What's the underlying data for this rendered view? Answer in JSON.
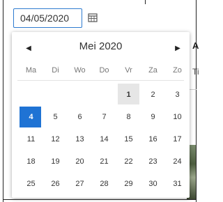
{
  "datepicker": {
    "input_value": "04/05/2020",
    "calendar_icon": "calendar-icon",
    "month_title": "Mei 2020",
    "prev_icon": "chevron-left-icon",
    "next_icon": "chevron-right-icon",
    "weekdays": [
      "Ma",
      "Di",
      "Wo",
      "Do",
      "Vr",
      "Za",
      "Zo"
    ],
    "weeks": [
      [
        "",
        "",
        "",
        "",
        "1",
        "2",
        "3"
      ],
      [
        "4",
        "5",
        "6",
        "7",
        "8",
        "9",
        "10"
      ],
      [
        "11",
        "12",
        "13",
        "14",
        "15",
        "16",
        "17"
      ],
      [
        "18",
        "19",
        "20",
        "21",
        "22",
        "23",
        "24"
      ],
      [
        "25",
        "26",
        "27",
        "28",
        "29",
        "30",
        "31"
      ]
    ],
    "today": "1",
    "selected": "4",
    "accent_color": "#1f73d4"
  },
  "background": {
    "letter_1": "A",
    "letter_2": "Ti"
  }
}
